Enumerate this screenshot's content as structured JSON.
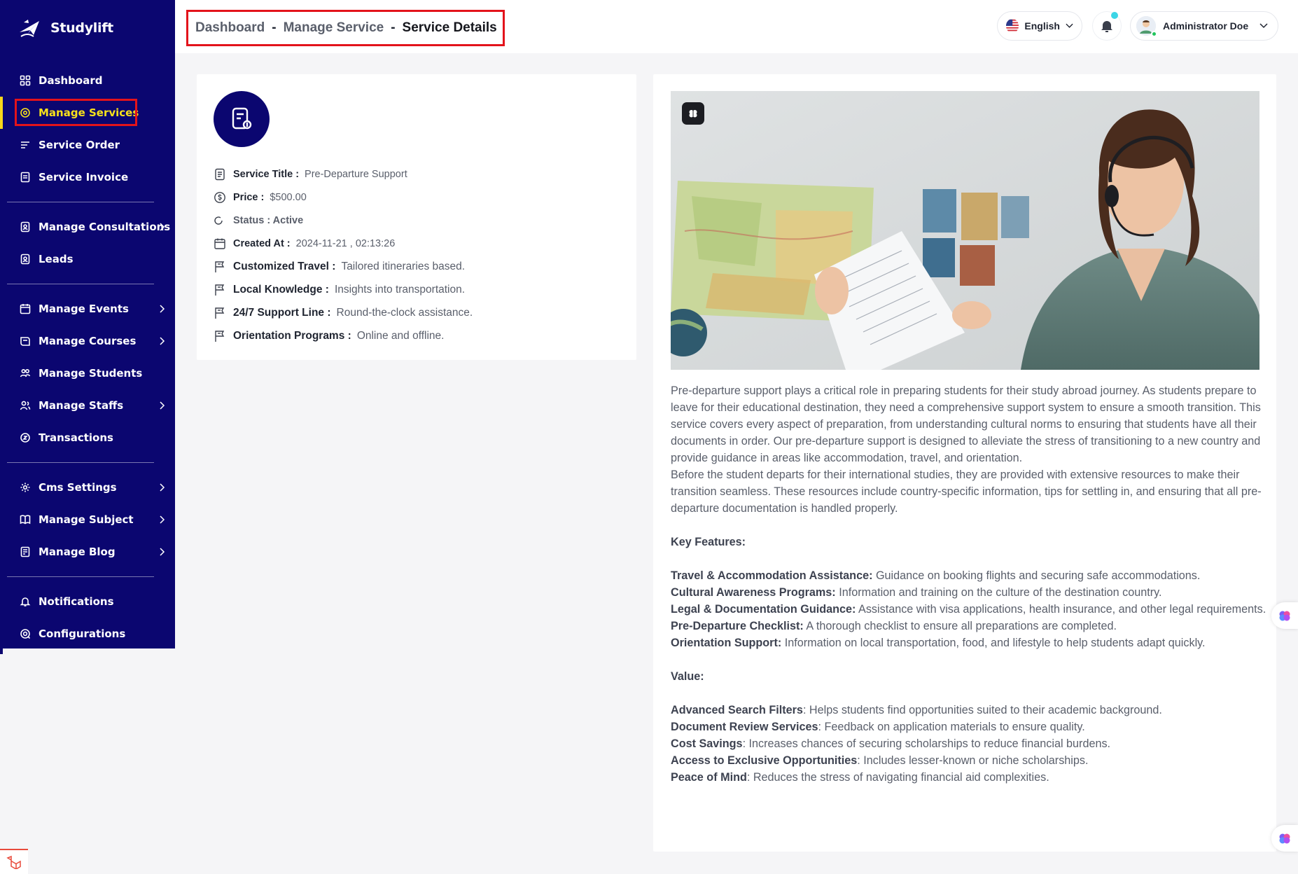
{
  "app": {
    "name": "Studylift"
  },
  "sidebar": {
    "items": [
      {
        "label": "Dashboard",
        "icon": "dashboard-icon"
      },
      {
        "label": "Manage Services",
        "icon": "services-icon",
        "active": true
      },
      {
        "label": "Service Order",
        "icon": "order-icon"
      },
      {
        "label": "Service Invoice",
        "icon": "invoice-icon"
      },
      {
        "label": "Manage Consultations",
        "icon": "consultation-icon",
        "has_children": true
      },
      {
        "label": "Leads",
        "icon": "leads-icon"
      },
      {
        "label": "Manage Events",
        "icon": "events-icon",
        "has_children": true
      },
      {
        "label": "Manage Courses",
        "icon": "courses-icon",
        "has_children": true
      },
      {
        "label": "Manage Students",
        "icon": "students-icon"
      },
      {
        "label": "Manage Staffs",
        "icon": "staffs-icon",
        "has_children": true
      },
      {
        "label": "Transactions",
        "icon": "transactions-icon"
      },
      {
        "label": "Cms Settings",
        "icon": "cms-icon",
        "has_children": true
      },
      {
        "label": "Manage Subject",
        "icon": "subject-icon",
        "has_children": true
      },
      {
        "label": "Manage Blog",
        "icon": "blog-icon",
        "has_children": true
      },
      {
        "label": "Notifications",
        "icon": "bell-icon"
      },
      {
        "label": "Configurations",
        "icon": "config-icon"
      }
    ]
  },
  "header": {
    "breadcrumb": [
      "Dashboard",
      "Manage Service",
      "Service Details"
    ],
    "breadcrumb_sep": "-",
    "language": "English",
    "user_name": "Administrator Doe"
  },
  "service": {
    "title_label": "Service Title :",
    "title": "Pre-Departure Support",
    "price_label": "Price :",
    "price": "$500.00",
    "status": "Status : Active",
    "created_label": "Created At :",
    "created_at": "2024-11-21 , 02:13:26",
    "features": [
      {
        "label": "Customized Travel :",
        "value": "Tailored itineraries based."
      },
      {
        "label": "Local Knowledge :",
        "value": "Insights into transportation."
      },
      {
        "label": "24/7 Support Line :",
        "value": "Round-the-clock assistance."
      },
      {
        "label": "Orientation Programs :",
        "value": "Online and offline."
      }
    ]
  },
  "description": {
    "para1": "Pre-departure support plays a critical role in preparing students for their study abroad journey. As students prepare to leave for their educational destination, they need a comprehensive support system to ensure a smooth transition. This service covers every aspect of preparation, from understanding cultural norms to ensuring that students have all their documents in order. Our pre-departure support is designed to alleviate the stress of transitioning to a new country and provide guidance in areas like accommodation, travel, and orientation.",
    "para2": "Before the student departs for their international studies, they are provided with extensive resources to make their transition seamless. These resources include country-specific information, tips for settling in, and ensuring that all pre-departure documentation is handled properly.",
    "key_features_heading": "Key Features:",
    "key_features": [
      {
        "title": "Travel & Accommodation Assistance:",
        "text": " Guidance on booking flights and securing safe accommodations."
      },
      {
        "title": "Cultural Awareness Programs:",
        "text": " Information and training on the culture of the destination country."
      },
      {
        "title": "Legal & Documentation Guidance:",
        "text": " Assistance with visa applications, health insurance, and other legal requirements."
      },
      {
        "title": "Pre-Departure Checklist:",
        "text": " A thorough checklist to ensure all preparations are completed."
      },
      {
        "title": "Orientation Support:",
        "text": " Information on local transportation, food, and lifestyle to help students adapt quickly."
      }
    ],
    "value_heading": "Value:",
    "values": [
      {
        "title": "Advanced Search Filters",
        "text": ": Helps students find opportunities suited to their academic background."
      },
      {
        "title": "Document Review Services",
        "text": ": Feedback on application materials to ensure quality."
      },
      {
        "title": "Cost Savings",
        "text": ": Increases chances of securing scholarships to reduce financial burdens."
      },
      {
        "title": "Access to Exclusive Opportunities",
        "text": ": Includes lesser-known or niche scholarships."
      },
      {
        "title": "Peace of Mind",
        "text": ": Reduces the stress of navigating financial aid complexities."
      }
    ]
  },
  "colors": {
    "sidebar_bg": "#0b0670",
    "active": "#f7e11b",
    "highlight_box": "#e3131b",
    "accent_dot": "#3bd5e6"
  }
}
